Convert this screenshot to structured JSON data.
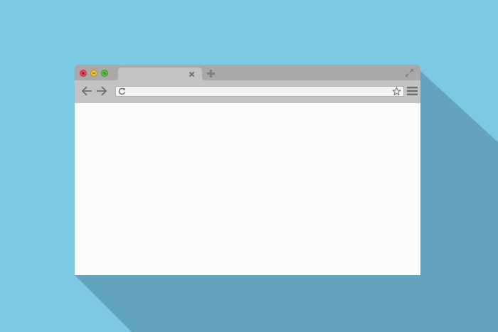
{
  "colors": {
    "background": "#7dc8e3",
    "shadow": "#64a3bc",
    "title_bar": "#a9a9a9",
    "tab": "#c3c3c3",
    "toolbar": "#c3c3c3",
    "content": "#fbfcfa",
    "close_button": "#e94a5f",
    "minimize_button": "#f3b93c",
    "maximize_button": "#58c146",
    "icon": "#707070"
  },
  "window_controls": {
    "close_icon": "close-icon",
    "minimize_icon": "minus-icon",
    "maximize_icon": "expand-icon"
  },
  "tabs": [
    {
      "title": "",
      "close_icon": "close-icon"
    }
  ],
  "new_tab_icon": "plus-icon",
  "fullscreen_icon": "fullscreen-icon",
  "toolbar": {
    "back_icon": "arrow-left-icon",
    "forward_icon": "arrow-right-icon",
    "reload_icon": "reload-icon",
    "bookmark_icon": "star-icon",
    "menu_icon": "hamburger-menu-icon"
  },
  "address_bar": {
    "value": "",
    "placeholder": ""
  }
}
